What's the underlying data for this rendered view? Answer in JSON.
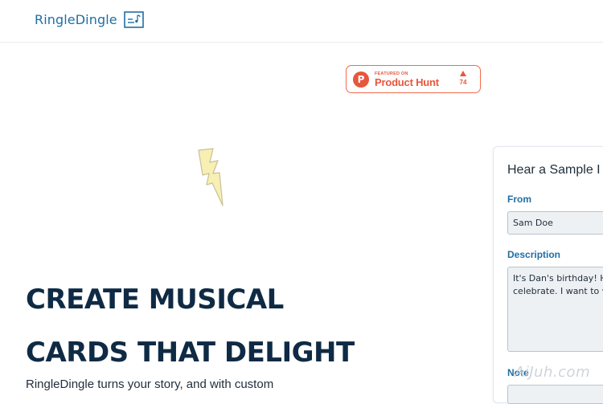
{
  "header": {
    "brand_name": "RingleDingle",
    "logo_icon": "music-note-card-icon"
  },
  "product_hunt": {
    "featured_label": "FEATURED ON",
    "name": "Product Hunt",
    "logo_letter": "P",
    "votes": "74",
    "color": "#e8563c"
  },
  "hero": {
    "title_line1": "CREATE MUSICAL",
    "title_line2": "CARDS THAT DELIGHT",
    "subtitle": "RingleDingle turns your story, and with custom",
    "accent_icon": "lightning-bolt-icon"
  },
  "sample_form": {
    "heading": "Hear a Sample I",
    "from_label": "From",
    "from_value": "Sam Doe",
    "description_label": "Description",
    "description_line1": "It's Dan's birthday! He",
    "description_line2": "celebrate. I want to w",
    "note_label": "Note"
  },
  "watermark": "AiJuh.com",
  "colors": {
    "brand": "#1f6ea3",
    "heading": "#0f2a44",
    "bolt_fill": "#f7efb3"
  }
}
